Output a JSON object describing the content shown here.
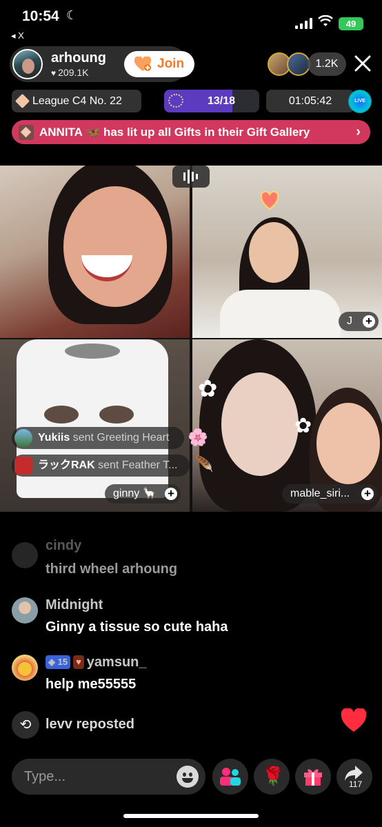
{
  "status_bar": {
    "time": "10:54",
    "battery": "49",
    "back_label": "◂ X"
  },
  "host": {
    "name": "arhoung",
    "likes": "209.1K",
    "join_label": "Join"
  },
  "viewers": {
    "count": "1.2K",
    "avatar_labels": [
      "400",
      "400"
    ]
  },
  "league": {
    "label": "League C4 No. 22"
  },
  "ranking": {
    "value": "13/18",
    "progress": 0.72
  },
  "timer": {
    "value": "01:05:42"
  },
  "live_badge": "LIVE",
  "gift_banner": {
    "text": "ANNITA 🦋 has lit up all Gifts in their Gift Gallery"
  },
  "tiles": [
    {
      "label": ""
    },
    {
      "label": "J"
    },
    {
      "label": "ginny 🦙"
    },
    {
      "label": "mable_siri..."
    }
  ],
  "gift_notes": [
    {
      "user": "Yukiis",
      "action": "sent Greeting Heart"
    },
    {
      "user": "ラックRAK",
      "action": "sent Feather T..."
    }
  ],
  "comments": [
    {
      "user": "cindy",
      "text": "third wheel arhoung"
    },
    {
      "user": "Midnight",
      "text": "Ginny a tissue so cute haha"
    },
    {
      "user": "yamsun_",
      "text": "help me55555",
      "level_badge": "15"
    }
  ],
  "repost": {
    "user": "levv",
    "action": "reposted"
  },
  "input": {
    "placeholder": "Type..."
  },
  "share": {
    "count": "117"
  },
  "colors": {
    "join": "#f47a23",
    "gift_banner": "#d2385e",
    "ranking": "#5b3bbf",
    "battery": "#34c759",
    "heart": "#ff2d3d"
  }
}
